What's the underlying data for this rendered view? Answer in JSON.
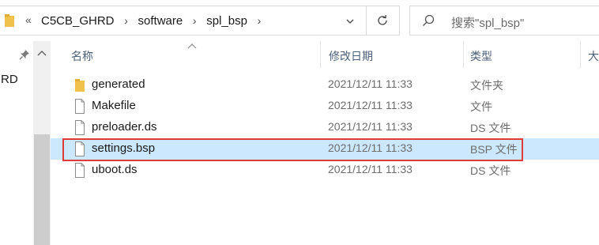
{
  "address_bar": {
    "overflow_glyph": "«",
    "breadcrumbs": [
      "C5CB_GHRD",
      "software",
      "spl_bsp"
    ],
    "arrow_glyph": "›"
  },
  "search": {
    "placeholder": "搜索\"spl_bsp\""
  },
  "nav_pane": {
    "partial_label": "RD"
  },
  "columns": {
    "name": "名称",
    "date_modified": "修改日期",
    "type": "类型",
    "size_partial": "大"
  },
  "files": [
    {
      "name": "generated",
      "date": "2021/12/11 11:33",
      "type": "文件夹",
      "icon": "folder-icon",
      "selected": false
    },
    {
      "name": "Makefile",
      "date": "2021/12/11 11:33",
      "type": "文件",
      "icon": "file-icon",
      "selected": false
    },
    {
      "name": "preloader.ds",
      "date": "2021/12/11 11:33",
      "type": "DS 文件",
      "icon": "file-icon",
      "selected": false
    },
    {
      "name": "settings.bsp",
      "date": "2021/12/11 11:33",
      "type": "BSP 文件",
      "icon": "file-icon",
      "selected": true
    },
    {
      "name": "uboot.ds",
      "date": "2021/12/11 11:33",
      "type": "DS 文件",
      "icon": "file-icon",
      "selected": false
    }
  ],
  "colors": {
    "selection": "#cce8ff",
    "highlight_border": "#e03b3b",
    "folder": "#f0c24b"
  }
}
